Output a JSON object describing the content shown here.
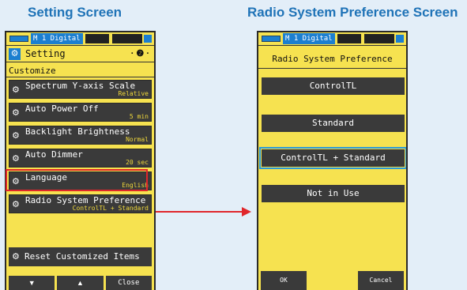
{
  "headings": {
    "left": "Setting Screen",
    "right": "Radio System Preference Screen"
  },
  "left_device": {
    "status_mode": "M 1 Digital",
    "title": "Setting",
    "page_indicator": "· ❷ ·",
    "section": "Customize",
    "items": [
      {
        "label": "Spectrum Y-axis Scale",
        "value": "Relative"
      },
      {
        "label": "Auto Power Off",
        "value": "5 min"
      },
      {
        "label": "Backlight Brightness",
        "value": "Normal"
      },
      {
        "label": "Auto Dimmer",
        "value": "20 sec"
      },
      {
        "label": "Language",
        "value": "English"
      },
      {
        "label": "Radio System Preference",
        "value": "ControlTL + Standard"
      }
    ],
    "reset_label": "Reset Customized Items",
    "softkeys": {
      "down": "▼",
      "up": "▲",
      "close": "Close"
    }
  },
  "right_device": {
    "status_mode": "M 1 Digital",
    "title": "Radio System Preference",
    "options": [
      "ControlTL",
      "Standard",
      "ControlTL + Standard",
      "Not in Use"
    ],
    "selected_option": "ControlTL + Standard",
    "softkeys": {
      "ok": "OK",
      "cancel": "Cancel"
    }
  },
  "colors": {
    "heading": "#1f73b7",
    "device_bg": "#f6e250",
    "button_bg": "#3a3a3a",
    "value_text": "#f0d83a",
    "highlight": "#e0262b",
    "selection_outline": "#2a9bd8"
  },
  "icons": {
    "item_icon": "gears-icon",
    "title_icon": "settings-icon"
  }
}
